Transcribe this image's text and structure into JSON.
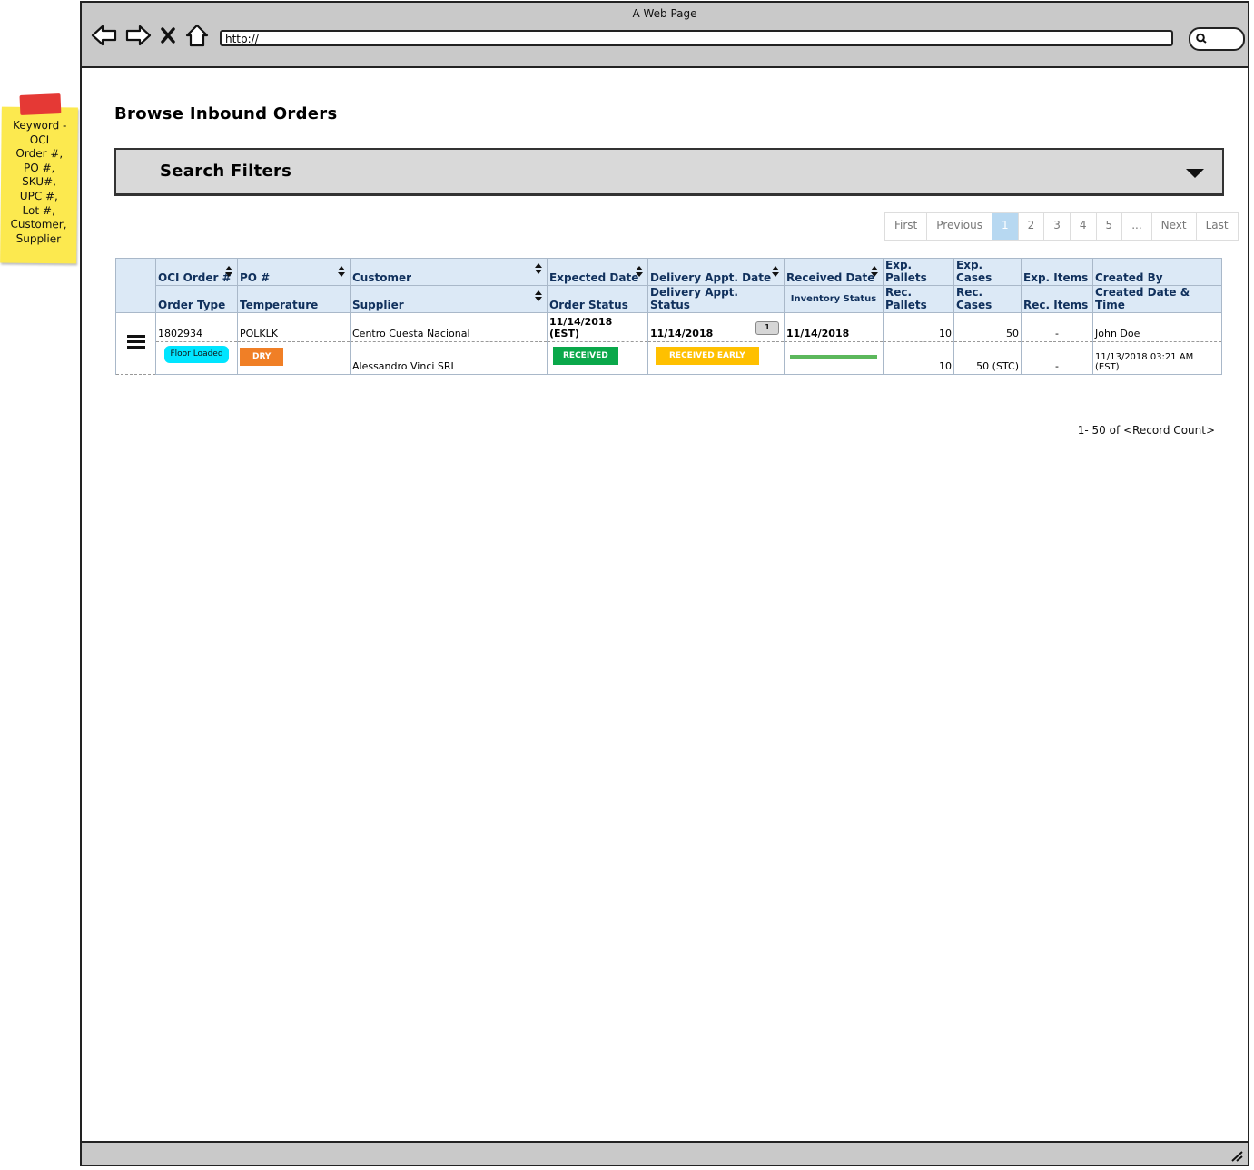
{
  "browser": {
    "window_title": "A Web Page",
    "url": "http://"
  },
  "sticky_note": {
    "text": "Keyword -\nOCI\nOrder #,\nPO #,\nSKU#,\nUPC #,\nLot #,\nCustomer,\nSupplier"
  },
  "page": {
    "title": "Browse Inbound Orders",
    "filters_label": "Search Filters"
  },
  "pagination": {
    "first": "First",
    "previous": "Previous",
    "pages": [
      "1",
      "2",
      "3",
      "4",
      "5"
    ],
    "current": "1",
    "ellipsis": "...",
    "next": "Next",
    "last": "Last"
  },
  "table": {
    "header_top": [
      "OCI Order #",
      "PO #",
      "Customer",
      "Expected Date",
      "Delivery Appt. Date",
      "Received Date",
      "Exp. Pallets",
      "Exp. Cases",
      "Exp. Items",
      "Created By"
    ],
    "header_bottom": [
      "Order Type",
      "Temperature",
      "Supplier",
      "Order Status",
      "Delivery Appt. Status",
      "Inventory Status",
      "Rec. Pallets",
      "Rec. Cases",
      "Rec. Items",
      "Created Date & Time"
    ],
    "rows": [
      {
        "oci_order": "1802934",
        "po": "POLKLK",
        "customer": "Centro Cuesta Nacional",
        "expected_date": "11/14/2018 (EST)",
        "delivery_appt_date": "11/14/2018",
        "delivery_appt_count": "1",
        "received_date": "11/14/2018",
        "exp_pallets": "10",
        "exp_cases": "50",
        "exp_items": "-",
        "created_by": "John Doe",
        "order_type": "Floor Loaded",
        "temperature": "DRY",
        "supplier": "Alessandro Vinci SRL",
        "order_status": "RECEIVED",
        "delivery_appt_status": "RECEIVED EARLY",
        "inventory_status_fraction": 1.0,
        "rec_pallets": "10",
        "rec_cases": "50 (STC)",
        "rec_items": "-",
        "created_datetime": "11/13/2018 03:21 AM (EST)"
      }
    ]
  },
  "footer": {
    "record_count": "1- 50 of <Record Count>"
  },
  "colors": {
    "header_bg": "#dce9f6",
    "header_text": "#10305c",
    "order_type_badge": "#00e5ff",
    "temperature_badge": "#f07f26",
    "order_status_badge": "#0aa84a",
    "appt_status_badge": "#ffc000",
    "inventory_bar": "#5cb85c",
    "sticky_note": "#fce94f"
  }
}
